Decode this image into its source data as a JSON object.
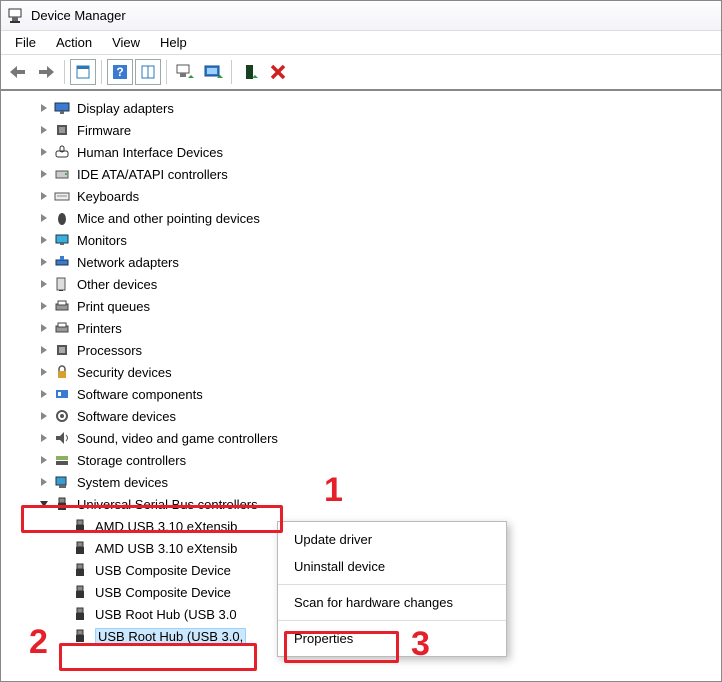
{
  "window": {
    "title": "Device Manager"
  },
  "menu": {
    "items": [
      "File",
      "Action",
      "View",
      "Help"
    ]
  },
  "toolbar_icons": [
    "back",
    "forward",
    "sep",
    "props",
    "sep",
    "help",
    "panel",
    "sep",
    "scan",
    "monitor",
    "sep",
    "enable",
    "delete"
  ],
  "tree": {
    "top": [
      "Display adapters",
      "Firmware",
      "Human Interface Devices",
      "IDE ATA/ATAPI controllers",
      "Keyboards",
      "Mice and other pointing devices",
      "Monitors",
      "Network adapters",
      "Other devices",
      "Print queues",
      "Printers",
      "Processors",
      "Security devices",
      "Software components",
      "Software devices",
      "Sound, video and game controllers",
      "Storage controllers",
      "System devices"
    ],
    "usb_header": "Universal Serial Bus controllers",
    "usb_children": [
      "AMD USB 3.10 eXtensib",
      "AMD USB 3.10 eXtensib",
      "USB Composite Device",
      "USB Composite Device",
      "USB Root Hub (USB 3.0",
      "USB Root Hub (USB 3.0,"
    ]
  },
  "context_menu": {
    "items": [
      "Update driver",
      "Uninstall device",
      "Scan for hardware changes",
      "Properties"
    ]
  },
  "annotations": {
    "one": "1",
    "two": "2",
    "three": "3"
  }
}
